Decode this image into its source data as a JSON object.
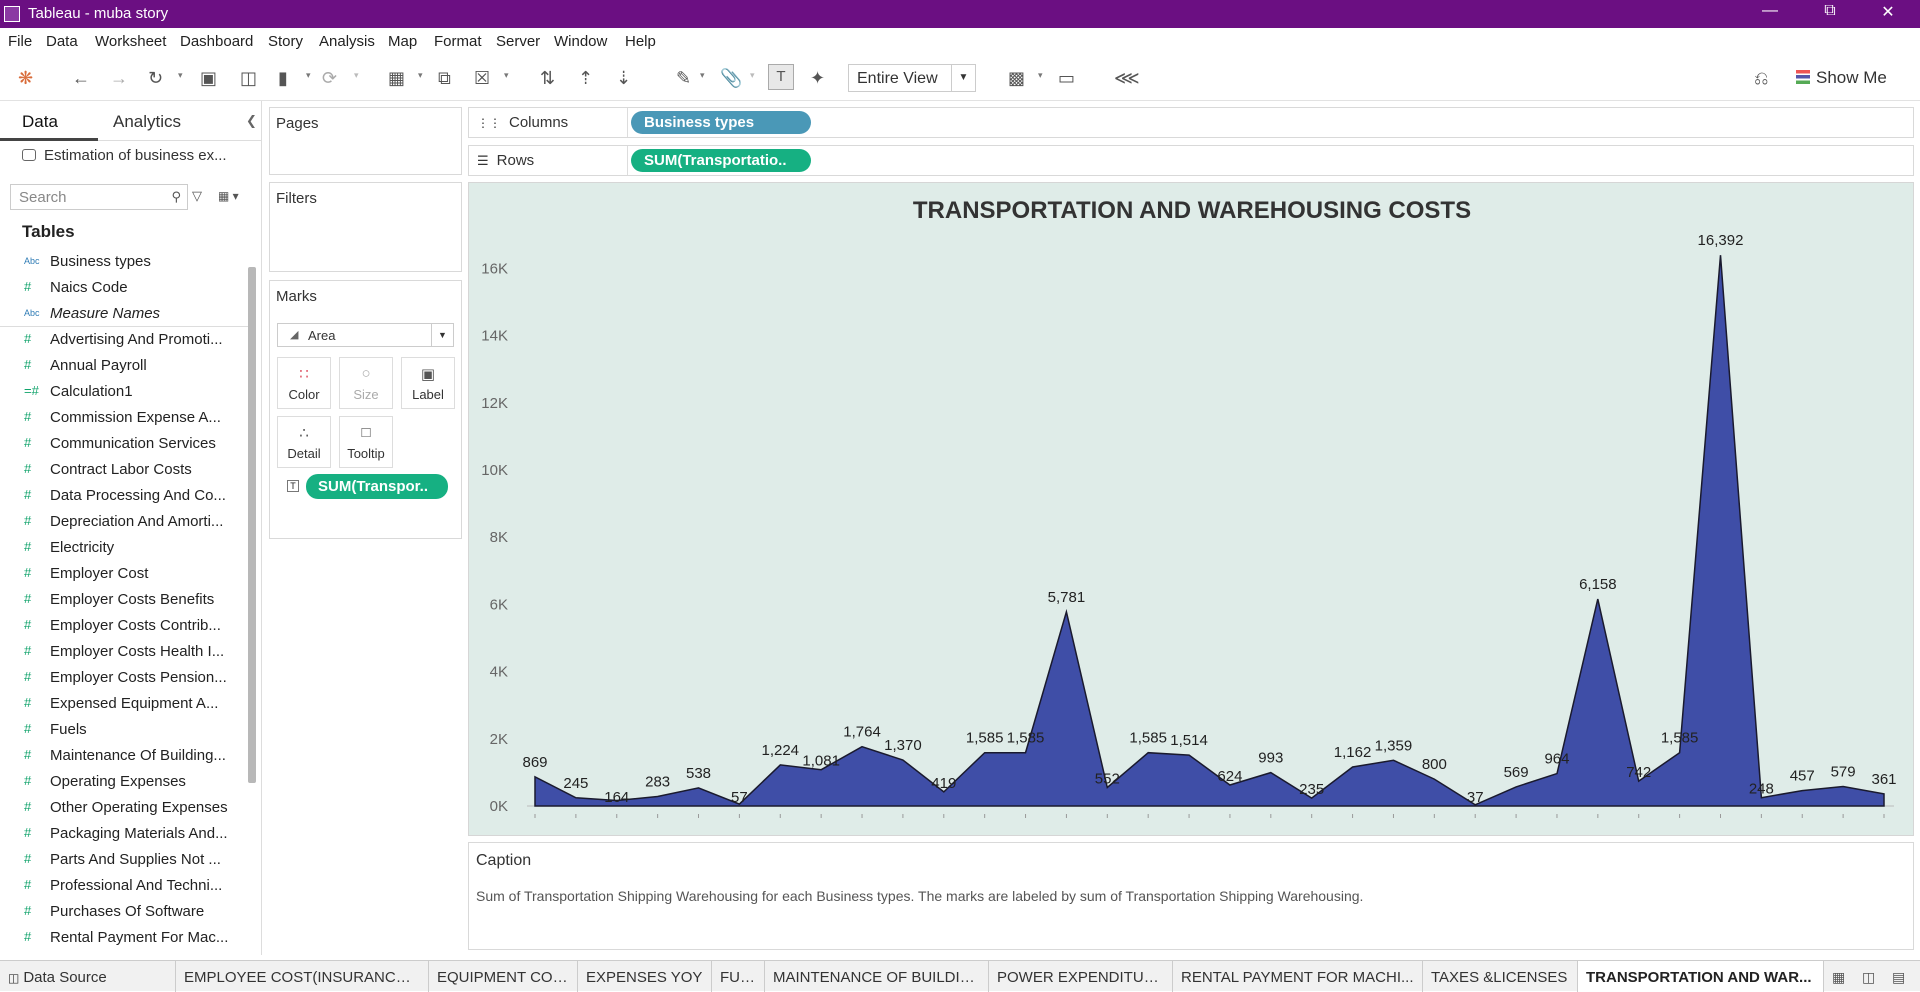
{
  "window": {
    "title": "Tableau - muba story"
  },
  "menu": [
    "File",
    "Data",
    "Worksheet",
    "Dashboard",
    "Story",
    "Analysis",
    "Map",
    "Format",
    "Server",
    "Window",
    "Help"
  ],
  "toolbar": {
    "fit": "Entire View",
    "show_me": "Show Me"
  },
  "data_pane": {
    "tabs": [
      "Data",
      "Analytics"
    ],
    "datasource": "Estimation of business ex...",
    "search_placeholder": "Search",
    "tables_header": "Tables",
    "fields": [
      {
        "type": "Abc",
        "name": "Business types"
      },
      {
        "type": "#",
        "name": "Naics Code"
      },
      {
        "type": "Abc",
        "name": "Measure Names"
      },
      {
        "type": "#",
        "name": "Advertising And Promoti..."
      },
      {
        "type": "#",
        "name": "Annual Payroll"
      },
      {
        "type": "=#",
        "name": "Calculation1"
      },
      {
        "type": "#",
        "name": "Commission Expense A..."
      },
      {
        "type": "#",
        "name": "Communication Services"
      },
      {
        "type": "#",
        "name": "Contract Labor Costs"
      },
      {
        "type": "#",
        "name": "Data Processing And Co..."
      },
      {
        "type": "#",
        "name": "Depreciation And Amorti..."
      },
      {
        "type": "#",
        "name": "Electricity"
      },
      {
        "type": "#",
        "name": "Employer Cost"
      },
      {
        "type": "#",
        "name": "Employer Costs Benefits"
      },
      {
        "type": "#",
        "name": "Employer Costs Contrib..."
      },
      {
        "type": "#",
        "name": "Employer Costs Health I..."
      },
      {
        "type": "#",
        "name": "Employer Costs Pension..."
      },
      {
        "type": "#",
        "name": "Expensed Equipment A..."
      },
      {
        "type": "#",
        "name": "Fuels"
      },
      {
        "type": "#",
        "name": "Maintenance Of Building..."
      },
      {
        "type": "#",
        "name": "Operating Expenses"
      },
      {
        "type": "#",
        "name": "Other Operating Expenses"
      },
      {
        "type": "#",
        "name": "Packaging Materials And..."
      },
      {
        "type": "#",
        "name": "Parts And Supplies Not ..."
      },
      {
        "type": "#",
        "name": "Professional And Techni..."
      },
      {
        "type": "#",
        "name": "Purchases Of Software"
      },
      {
        "type": "#",
        "name": "Rental Payment For Mac..."
      }
    ]
  },
  "cards": {
    "pages": "Pages",
    "filters": "Filters",
    "marks": "Marks",
    "mark_type": "Area",
    "mark_buttons": [
      "Color",
      "Size",
      "Label",
      "Detail",
      "Tooltip"
    ],
    "mark_pill": "SUM(Transpor.."
  },
  "shelves": {
    "columns_label": "Columns",
    "rows_label": "Rows",
    "columns_pill": "Business types",
    "rows_pill": "SUM(Transportatio.."
  },
  "caption": {
    "header": "Caption",
    "text": "Sum of Transportation Shipping Warehousing for each Business types.  The marks are labeled by sum of Transportation Shipping Warehousing."
  },
  "status_tabs": [
    "Data Source",
    "EMPLOYEE COST(INSURANCE ...",
    "EQUIPMENT COST",
    "EXPENSES YOY",
    "FUEL",
    "MAINTENANCE OF BUILDING",
    "POWER EXPENDITURE",
    "RENTAL PAYMENT FOR MACHI...",
    "TAXES &LICENSES",
    "TRANSPORTATION AND WAR..."
  ],
  "chart_data": {
    "type": "area",
    "title": "TRANSPORTATION AND WAREHOUSING COSTS",
    "ylim": [
      0,
      17000
    ],
    "yticks": [
      "0K",
      "2K",
      "4K",
      "6K",
      "8K",
      "10K",
      "12K",
      "14K",
      "16K"
    ],
    "color": "#3f4ea7",
    "values": [
      869,
      245,
      164,
      283,
      538,
      57,
      1224,
      1081,
      1764,
      1370,
      419,
      1585,
      1585,
      5781,
      552,
      1585,
      1514,
      624,
      993,
      235,
      1162,
      1359,
      800,
      37,
      569,
      964,
      6158,
      742,
      1585,
      16392,
      248,
      457,
      579,
      361
    ],
    "labels": [
      "869",
      "245",
      "164",
      "283",
      "538",
      "57",
      "1,224",
      "1,081",
      "1,764",
      "1,370",
      "419",
      "1,585",
      "1,585",
      "5,781",
      "552",
      "1,585",
      "1,514",
      "624",
      "993",
      "235",
      "1,162",
      "1,359",
      "800",
      "37",
      "569",
      "964",
      "6,158",
      "742",
      "1,585",
      "16,392",
      "248",
      "457",
      "579",
      "361"
    ]
  }
}
